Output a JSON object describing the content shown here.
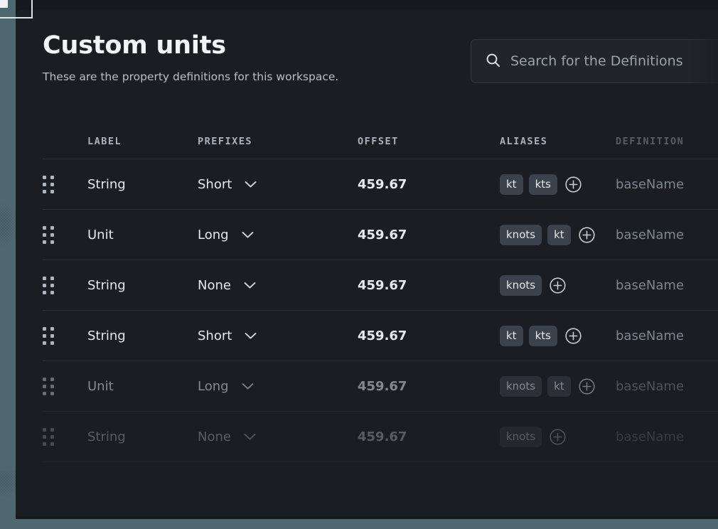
{
  "header": {
    "title": "Custom units",
    "subtitle": "These are the property definitions for this workspace."
  },
  "search": {
    "placeholder": "Search for the Definitions",
    "value": "",
    "icon": "search-icon"
  },
  "table": {
    "columns": [
      "LABEL",
      "PREFIXES",
      "OFFSET",
      "ALIASES",
      "DEFINITION"
    ],
    "rows": [
      {
        "handle": "drag-handle-icon",
        "label": "String",
        "prefix": "Short",
        "offset": "459.67",
        "aliases": [
          "kt",
          "kts"
        ],
        "add": "add-alias-icon",
        "definition": "baseName"
      },
      {
        "handle": "drag-handle-icon",
        "label": "Unit",
        "prefix": "Long",
        "offset": "459.67",
        "aliases": [
          "knots",
          "kt"
        ],
        "add": "add-alias-icon",
        "definition": "baseName"
      },
      {
        "handle": "drag-handle-icon",
        "label": "String",
        "prefix": "None",
        "offset": "459.67",
        "aliases": [
          "knots"
        ],
        "add": "add-alias-icon",
        "definition": "baseName"
      },
      {
        "handle": "drag-handle-icon",
        "label": "String",
        "prefix": "Short",
        "offset": "459.67",
        "aliases": [
          "kt",
          "kts"
        ],
        "add": "add-alias-icon",
        "definition": "baseName"
      },
      {
        "handle": "drag-handle-icon",
        "label": "Unit",
        "prefix": "Long",
        "offset": "459.67",
        "aliases": [
          "knots",
          "kt"
        ],
        "add": "add-alias-icon",
        "definition": "baseName"
      },
      {
        "handle": "drag-handle-icon",
        "label": "String",
        "prefix": "None",
        "offset": "459.67",
        "aliases": [
          "knots"
        ],
        "add": "add-alias-icon",
        "definition": "baseName"
      }
    ]
  },
  "colors": {
    "backdrop": "#4e6870",
    "card": "#1a1d21",
    "sheet": "#15181c",
    "search_bg": "#212529",
    "chip_bg": "#3b424b",
    "text_primary": "#e6eaee",
    "text_muted": "#7d868f",
    "header_text": "#aab3bb",
    "divider": "#2b3035"
  }
}
